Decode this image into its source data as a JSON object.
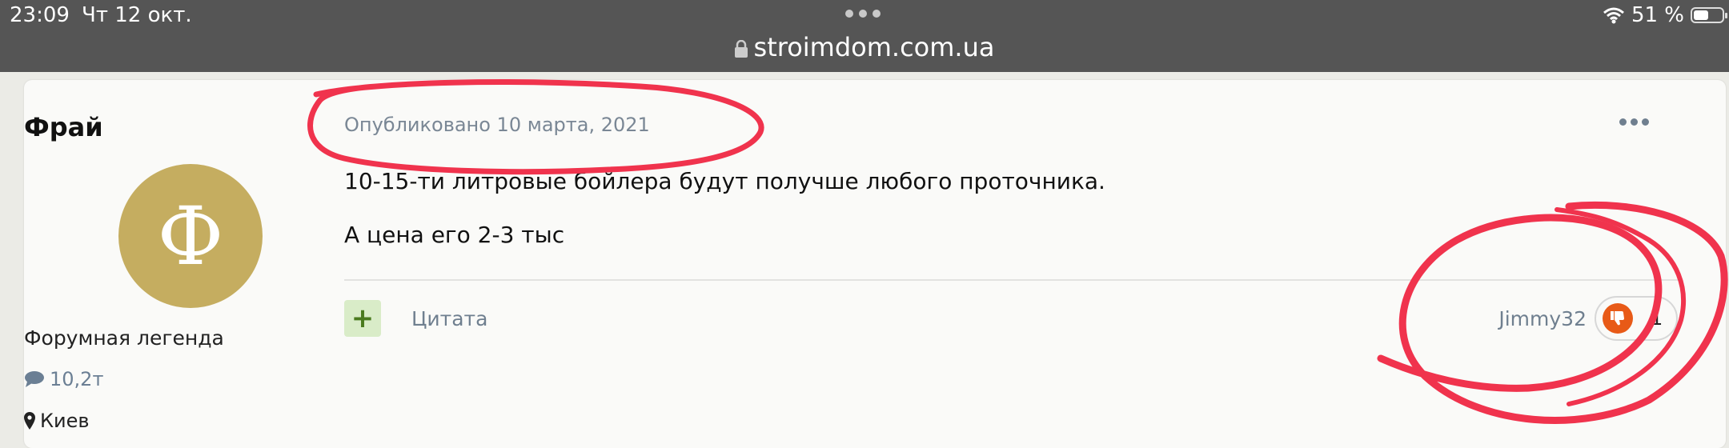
{
  "status_bar": {
    "time": "23:09",
    "date": "Чт 12 окт.",
    "battery": "51 %",
    "url": "stroimdom.com.ua"
  },
  "author": {
    "name": "Фрай",
    "avatar_letter": "Ф",
    "avatar_color": "#c5ad60",
    "rank": "Форумная легенда",
    "posts": "10,2т",
    "location": "Киев"
  },
  "post": {
    "date": "Опубликовано 10 марта, 2021",
    "paragraphs": [
      "10-15-ти литровые бойлера будут получше любого проточника.",
      "А цена его 2-3 тыс"
    ]
  },
  "footer": {
    "add_icon": "plus-icon",
    "quote_label": "Цитата",
    "reacted_user": "Jimmy32",
    "reaction_icon": "thumbs-down-icon",
    "reaction_color": "#e85a17",
    "reaction_count": "1"
  },
  "annotation_color": "#f0334d"
}
